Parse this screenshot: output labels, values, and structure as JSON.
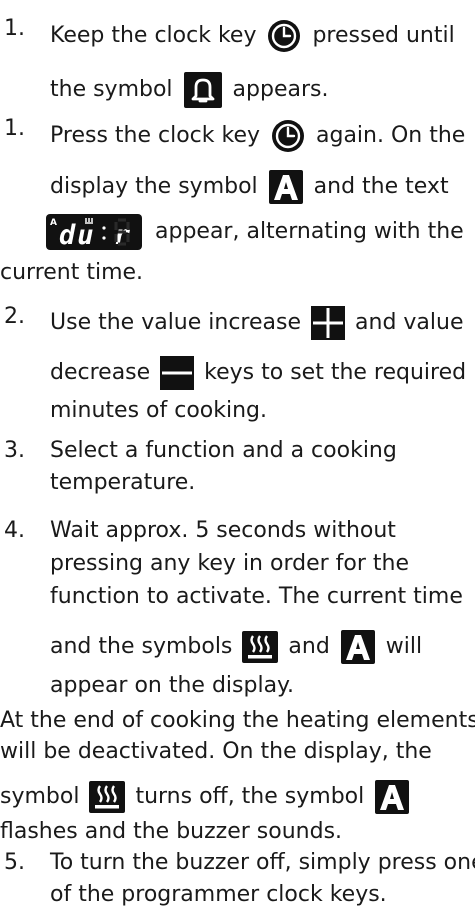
{
  "steps": [
    {
      "num": "1.",
      "a": "Keep the clock key",
      "b": "pressed until",
      "c": "the symbol",
      "d": "appears."
    },
    {
      "num": "1.",
      "a": "Press the clock key",
      "b": "again. On the",
      "c": "display the symbol",
      "d": "and the text",
      "e": "appear, alternating with the",
      "f": "current time."
    },
    {
      "num": "2.",
      "a": "Use the value increase",
      "b": "and value",
      "c": "decrease",
      "d": "keys to set the required",
      "e": "minutes of cooking."
    },
    {
      "num": "3.",
      "a": "Select a function and a cooking",
      "b": "temperature."
    },
    {
      "num": "4.",
      "a": "Wait approx. 5 seconds without",
      "b": "pressing any key in order for the",
      "c": "function to activate. The current time",
      "d": "and the symbols",
      "e": "and",
      "f": "will",
      "g": "appear on the display."
    },
    {
      "num": "5.",
      "a": "To turn the buzzer off, simply press one",
      "b": "of the programmer clock keys."
    }
  ],
  "end_paragraph": {
    "a": "At the end of cooking the heating elements",
    "b": "will be deactivated. On the display, the",
    "c": "symbol",
    "d": "turns off, the symbol",
    "e": "flashes and the buzzer sounds."
  },
  "display_text": {
    "indicator": "A",
    "chars": "du r"
  },
  "icons": {
    "clock": "clock-icon",
    "bell": "bell-icon",
    "auto": "auto-a-icon",
    "plus": "plus-icon",
    "minus": "minus-icon",
    "heat": "heating-elements-icon"
  },
  "colors": {
    "text": "#1a1a1a",
    "icon_bg": "#111111",
    "icon_fg": "#ffffff",
    "display_bg": "#111111",
    "display_fg": "#ffffff"
  }
}
